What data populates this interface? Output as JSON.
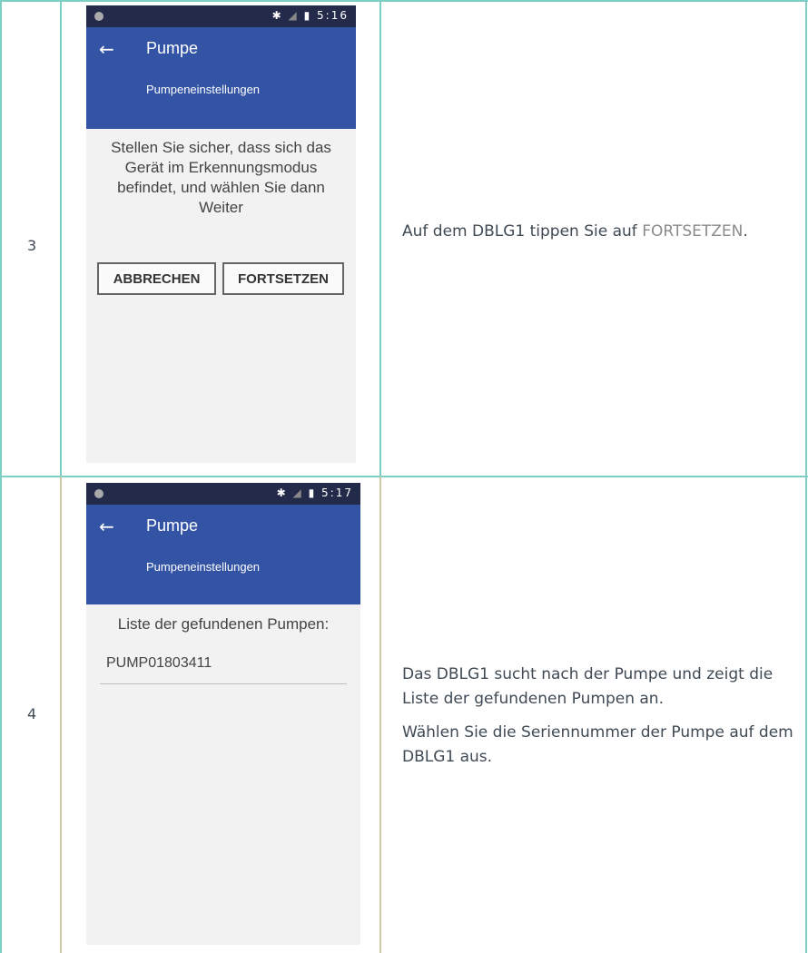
{
  "steps": [
    {
      "number": "3",
      "phone": {
        "status_time": "5:16",
        "title": "Pumpe",
        "subtitle": "Pumpeneinstellungen",
        "message": "Stellen Sie sicher, dass sich das Gerät im Erkennungsmodus befindet, und wählen Sie dann Weiter",
        "cancel_label": "ABBRECHEN",
        "continue_label": "FORTSETZEN"
      },
      "description": {
        "text_before": "Auf dem DBLG1 tippen Sie auf ",
        "link": "FORTSETZEN",
        "text_after": "."
      }
    },
    {
      "number": "4",
      "phone": {
        "status_time": "5:17",
        "title": "Pumpe",
        "subtitle": "Pumpeneinstellungen",
        "list_label": "Liste der gefundenen Pumpen:",
        "pump_item": "PUMP01803411"
      },
      "description": {
        "para1": "Das DBLG1 sucht nach der Pumpe und zeigt die Liste der gefundenen Pumpen an.",
        "para2": "Wählen Sie die Seriennummer der Pumpe auf dem DBLG1 aus."
      }
    }
  ],
  "icons": {
    "back": "arrow-left-icon",
    "bluetooth": "bluetooth-icon",
    "signal": "no-signal-icon",
    "battery": "battery-icon"
  },
  "colors": {
    "table_border": "#7ecfc3",
    "app_bar": "#3353a5",
    "status_bar": "#242b4a"
  }
}
